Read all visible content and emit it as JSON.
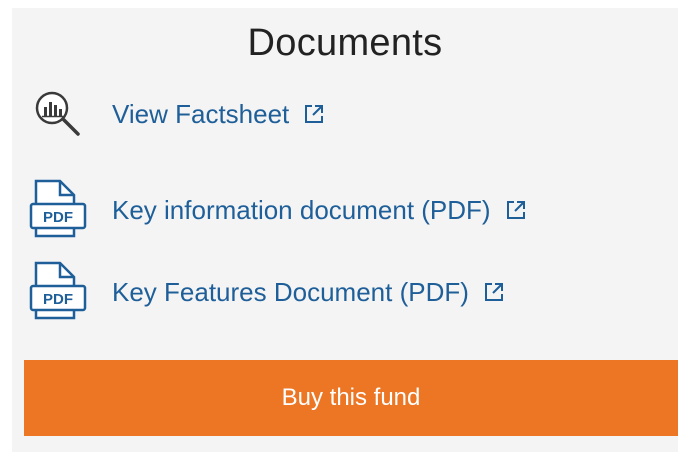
{
  "documents": {
    "title": "Documents",
    "links": [
      {
        "label": "View Factsheet",
        "icon": "factsheet-magnifier-icon"
      },
      {
        "label": "Key information document (PDF)",
        "icon": "pdf-file-icon"
      },
      {
        "label": "Key Features Document (PDF)",
        "icon": "pdf-file-icon"
      }
    ],
    "pdf_badge": "PDF",
    "buy_label": "Buy this fund"
  },
  "colors": {
    "link": "#1f5f99",
    "button": "#ed7624",
    "panel": "#f4f4f4"
  }
}
